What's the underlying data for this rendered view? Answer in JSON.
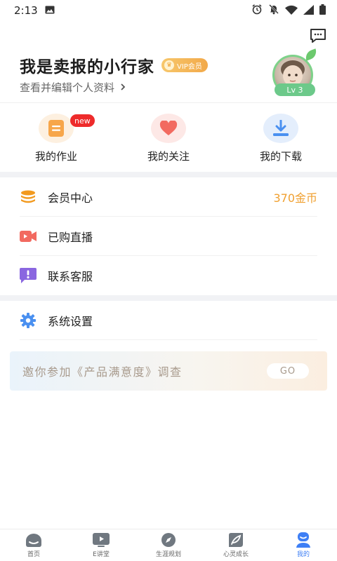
{
  "status_bar": {
    "time": "2:13",
    "icons": [
      "image-icon",
      "alarm-icon",
      "mute-icon",
      "wifi-icon",
      "signal-icon",
      "battery-icon"
    ]
  },
  "header": {
    "message_icon": "chat-bubble-icon"
  },
  "profile": {
    "name": "我是卖报的小行家",
    "vip_label": "VIP会员",
    "edit_label": "查看并编辑个人资料",
    "level": "Lv 3"
  },
  "quick_actions": [
    {
      "label": "我的作业",
      "icon": "homework-icon",
      "badge": "new",
      "color": "#f7a64a"
    },
    {
      "label": "我的关注",
      "icon": "heart-icon",
      "color": "#f26a60"
    },
    {
      "label": "我的下载",
      "icon": "download-icon",
      "color": "#4a90f0"
    }
  ],
  "menu": [
    {
      "label": "会员中心",
      "icon": "coins-icon",
      "value": "370金币",
      "color": "#f29a1f"
    },
    {
      "label": "已购直播",
      "icon": "video-camera-icon",
      "color": "#f26a60"
    },
    {
      "label": "联系客服",
      "icon": "feedback-icon",
      "color": "#8a66e0"
    },
    {
      "label": "系统设置",
      "icon": "gear-icon",
      "color": "#4a90f0"
    }
  ],
  "survey": {
    "text": "邀你参加《产品满意度》调查",
    "button": "GO"
  },
  "tabbar": [
    {
      "label": "首页",
      "icon": "home-icon"
    },
    {
      "label": "E讲堂",
      "icon": "play-tv-icon"
    },
    {
      "label": "生涯规划",
      "icon": "compass-icon"
    },
    {
      "label": "心灵成长",
      "icon": "leaf-icon"
    },
    {
      "label": "我的",
      "icon": "user-icon",
      "active": true
    }
  ],
  "colors": {
    "accent_blue": "#3e7ff5",
    "gold": "#f0a030",
    "vip_gold": "#f2a94a"
  }
}
